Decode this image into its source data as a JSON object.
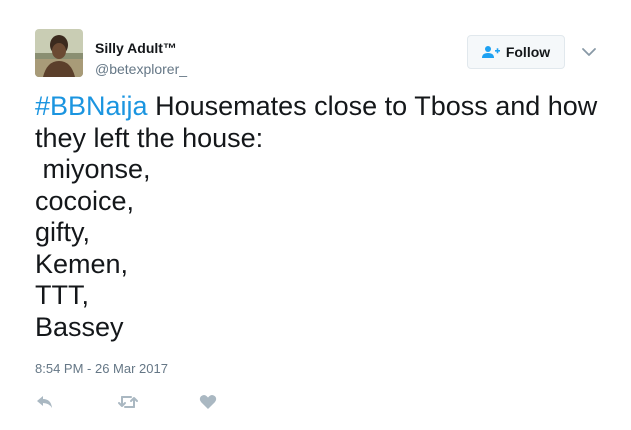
{
  "user": {
    "display_name": "Silly Adult™",
    "handle": "@betexplorer_"
  },
  "follow": {
    "label": "Follow"
  },
  "tweet": {
    "hashtag": "#BBNaija",
    "first_line_rest": " Housemates close to Tboss and how",
    "lines": [
      "they left the house:",
      " miyonse,",
      "cocoice,",
      "gifty,",
      "Kemen,",
      "TTT,",
      "Bassey"
    ]
  },
  "timestamp": "8:54 PM - 26 Mar 2017",
  "colors": {
    "link": "#1b95e0",
    "secondary_text": "#657786",
    "icon": "#aab8c2"
  },
  "icons": [
    "person-plus-icon",
    "chevron-down-icon",
    "reply-icon",
    "retweet-icon",
    "heart-icon"
  ]
}
